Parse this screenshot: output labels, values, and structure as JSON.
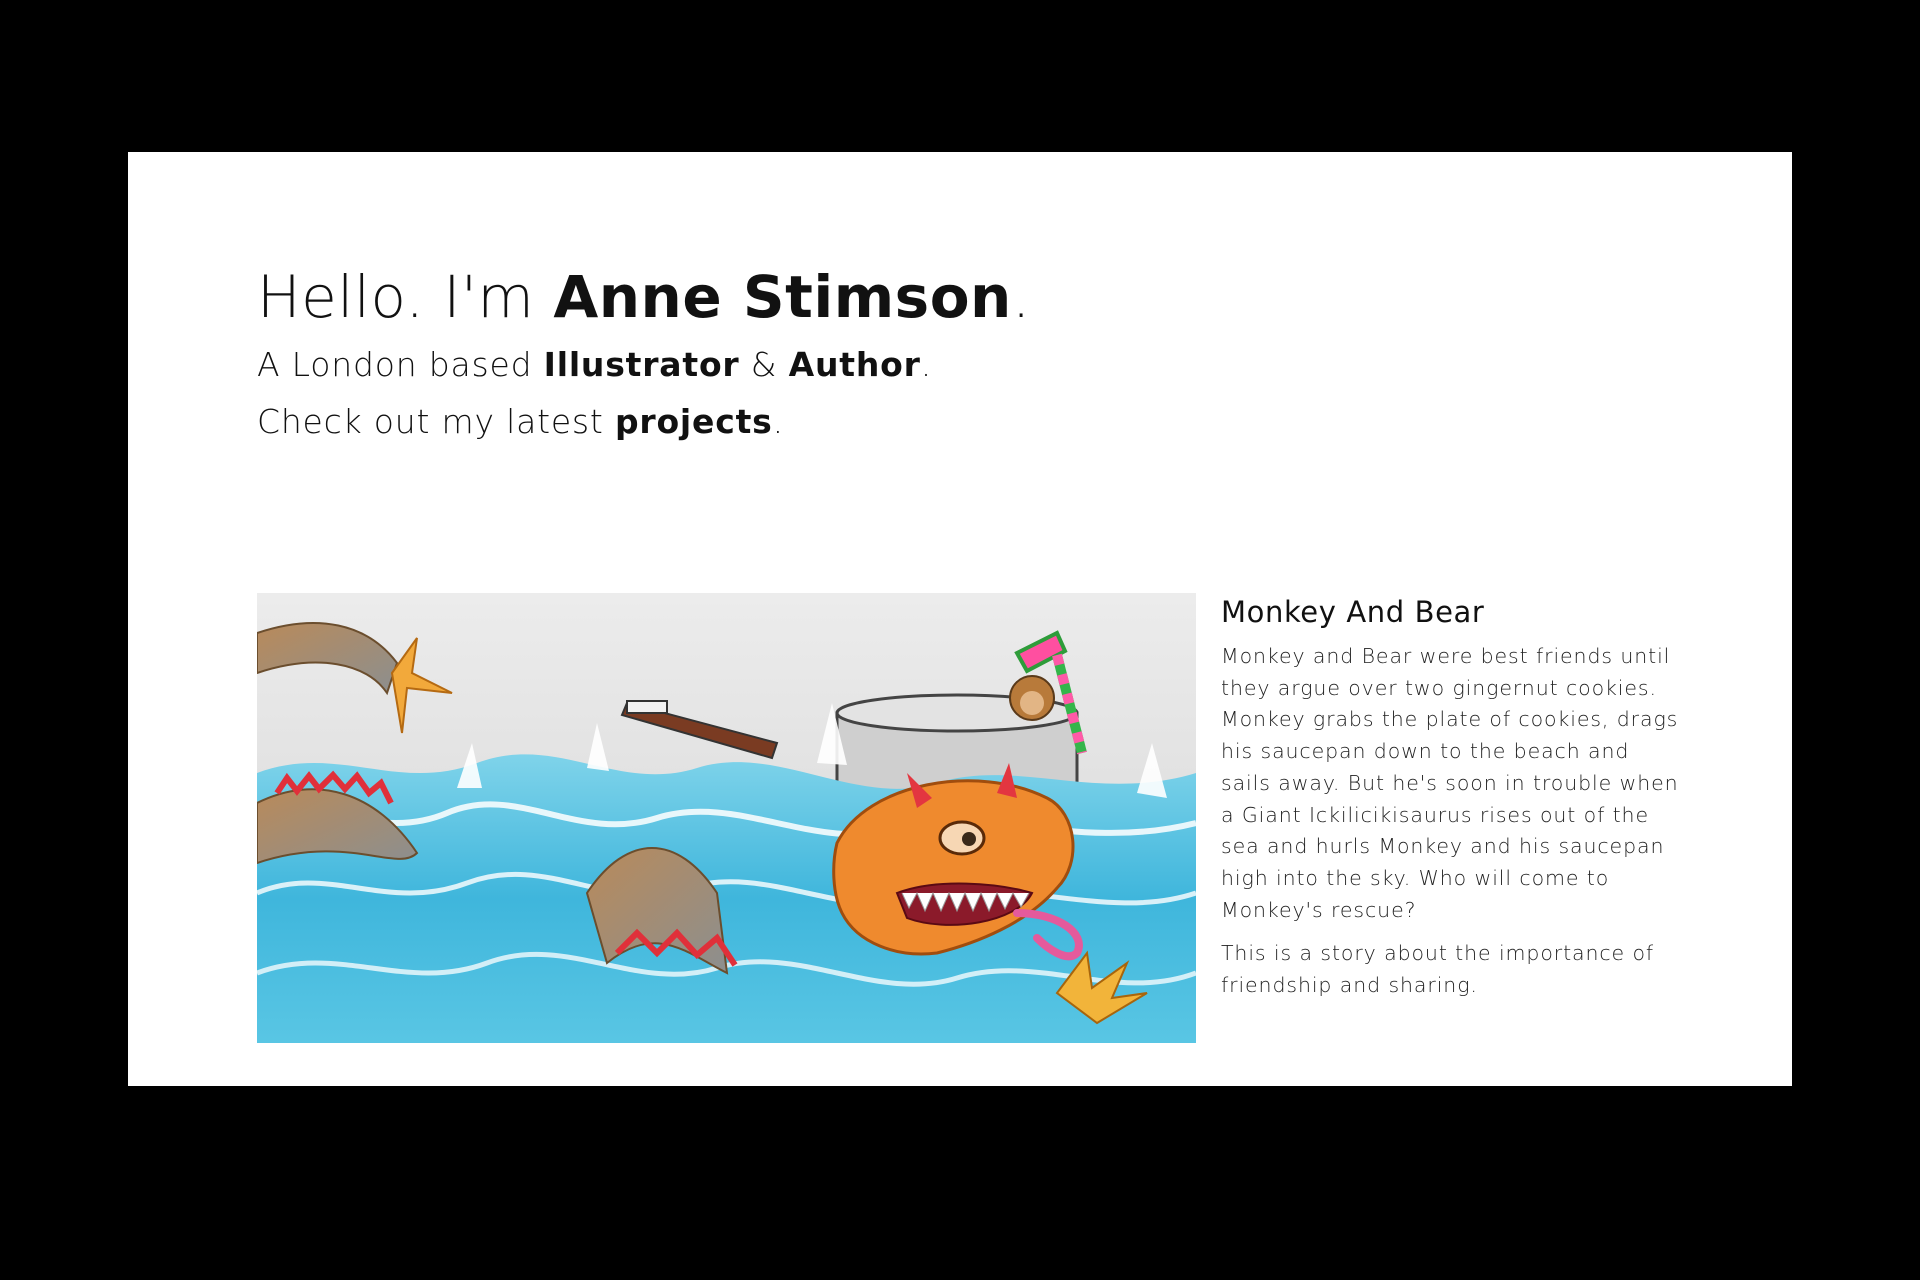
{
  "hero": {
    "greeting_prefix": "Hello. I'm ",
    "name": "Anne Stimson",
    "greeting_suffix": ".",
    "line1_prefix": "A London based ",
    "role1": "Illustrator",
    "line1_join": " & ",
    "role2": "Author",
    "line1_suffix": ".",
    "line2_prefix": "Check out my latest ",
    "projects_link": "projects",
    "line2_suffix": "."
  },
  "project": {
    "title": "Monkey And Bear",
    "paragraph1": "Monkey and Bear were best friends until they argue over two gingernut cookies. Monkey grabs the plate of cookies, drags his saucepan down to the beach and sails away. But he's soon in trouble when a Giant Ickilicikisaurus rises out of the sea and hurls Monkey and his saucepan high into the sky. Who will come to Monkey's rescue?",
    "paragraph2": "This is a story about the importance of friendship and sharing."
  },
  "colors": {
    "page_background": "#000000",
    "card_background": "#ffffff",
    "text": "#111111"
  }
}
